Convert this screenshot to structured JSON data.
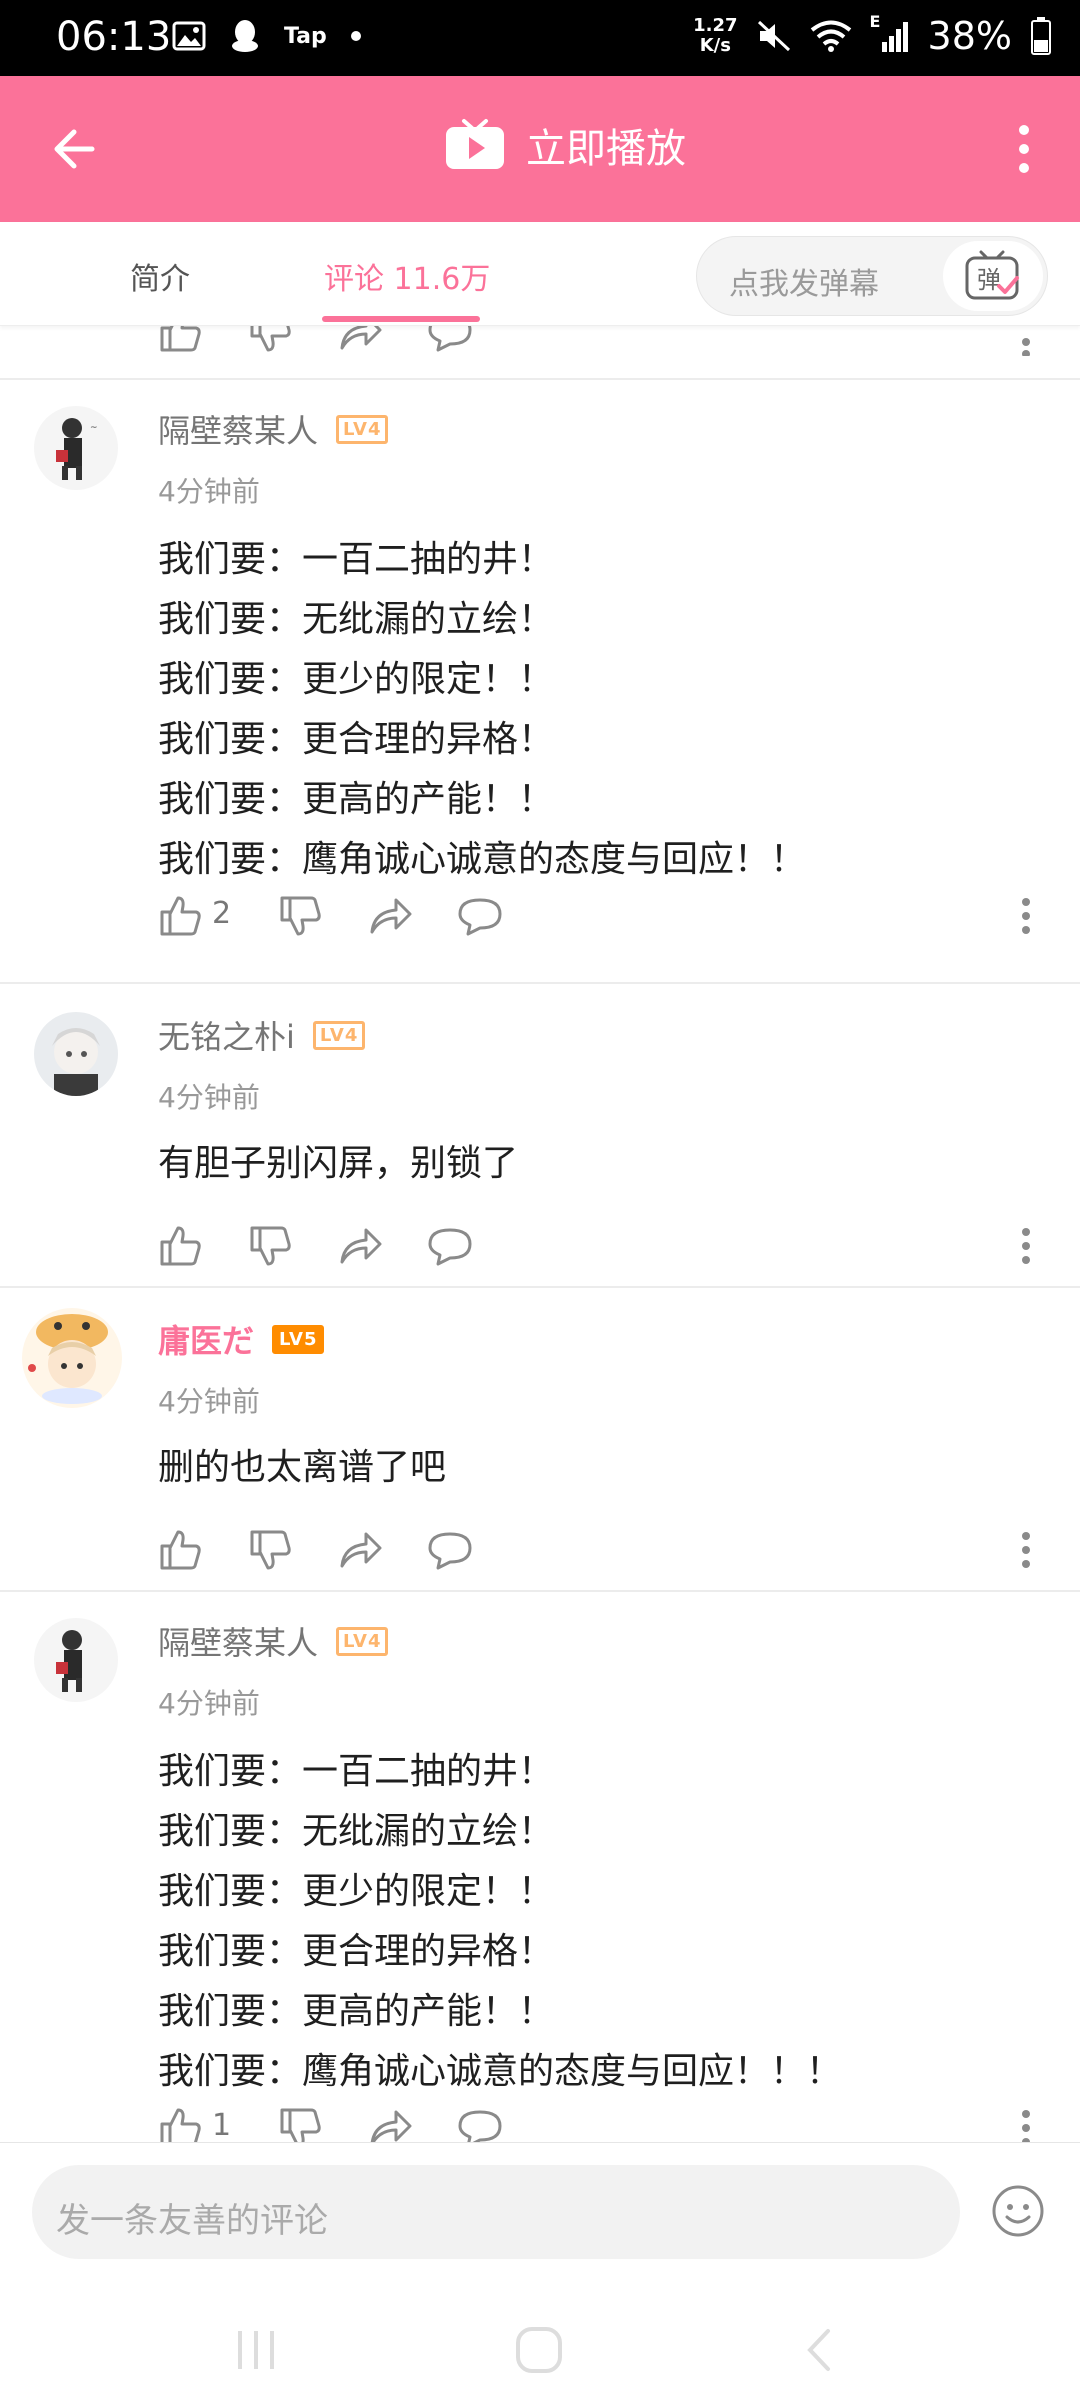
{
  "status_bar": {
    "time": "06:13",
    "net_speed_top": "1.27",
    "net_speed_bottom": "K/s",
    "tap_label": "Tap",
    "signal_letter": "E",
    "battery": "38%"
  },
  "header": {
    "title": "立即播放",
    "accent_color": "#fb7299"
  },
  "tabs": [
    {
      "label": "简介"
    },
    {
      "label": "评论 11.6万"
    }
  ],
  "danmaku": {
    "placeholder": "点我发弹幕",
    "icon_label": "弹"
  },
  "comments": [
    {
      "user": "隔壁蔡某人",
      "level": "LV4",
      "time": "4分钟前",
      "lines": [
        "我们要：一百二抽的井！",
        "我们要：无纰漏的立绘！",
        "我们要：更少的限定！！",
        "我们要：更合理的异格！",
        "我们要：更高的产能！！",
        "我们要：鹰角诚心诚意的态度与回应！！"
      ],
      "likes": "2"
    },
    {
      "user": "无铭之朴i",
      "level": "LV4",
      "time": "4分钟前",
      "lines": [
        "有胆子别闪屏，别锁了"
      ],
      "likes": ""
    },
    {
      "user": "庸医だ",
      "level": "LV5",
      "time": "4分钟前",
      "lines": [
        "删的也太离谱了吧"
      ],
      "likes": ""
    },
    {
      "user": "隔壁蔡某人",
      "level": "LV4",
      "time": "4分钟前",
      "lines": [
        "我们要：一百二抽的井！",
        "我们要：无纰漏的立绘！",
        "我们要：更少的限定！！",
        "我们要：更合理的异格！",
        "我们要：更高的产能！！",
        "我们要：鹰角诚心诚意的态度与回应！！！"
      ],
      "likes": "1"
    }
  ],
  "compose": {
    "placeholder": "发一条友善的评论"
  }
}
